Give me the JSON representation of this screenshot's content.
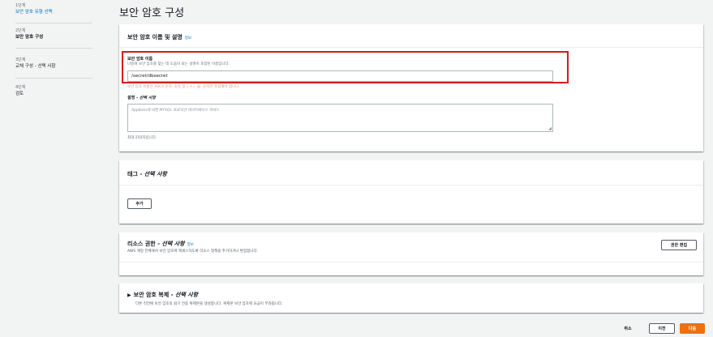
{
  "sidebar": {
    "steps": [
      {
        "num": "1단계",
        "label": "보안 암호 유형 선택"
      },
      {
        "num": "2단계",
        "label": "보안 암호 구성"
      },
      {
        "num": "3단계",
        "label": "교체 구성 - 선택 사항"
      },
      {
        "num": "4단계",
        "label": "검토"
      }
    ]
  },
  "page_title": "보안 암호 구성",
  "name_panel": {
    "title": "보안 암호 이름 및 설명",
    "info": "정보",
    "name_label": "보안 암호 이름",
    "name_desc": "나중에 보안 암호를 찾는 데 도움이 되는 설명이 포함된 이름입니다.",
    "name_value": "/secret/dbsecret",
    "name_hint": "보안 암호 이름은 ASCII 문자, 숫자 및 /_+=.@- 문자만 포함해야 합니다.",
    "desc_label": "설명",
    "desc_optional": "선택 사항",
    "desc_placeholder": "AppBeta에 대한 MYSQL 프로덕션 데이터베이스 액세스",
    "desc_hint": "최대 250자입니다."
  },
  "tags_panel": {
    "title": "태그",
    "optional": "선택 사항",
    "add_button": "추가"
  },
  "perm_panel": {
    "title": "리소스 권한",
    "optional": "선택 사항",
    "info": "정보",
    "desc": "AWS 계정 전체에서 보안 암호에 액세스하도록 리소스 정책을 추가하거나 편집합니다.",
    "edit_button": "권한 편집"
  },
  "replica_panel": {
    "title": "보안 암호 복제",
    "optional": "선택 사항",
    "desc": "다른 리전에 보안 암호의 읽기 전용 복제본을 생성합니다. 복제본 보안 암호에 요금이 부과됩니다."
  },
  "footer": {
    "cancel": "취소",
    "previous": "이전",
    "next": "다음"
  }
}
